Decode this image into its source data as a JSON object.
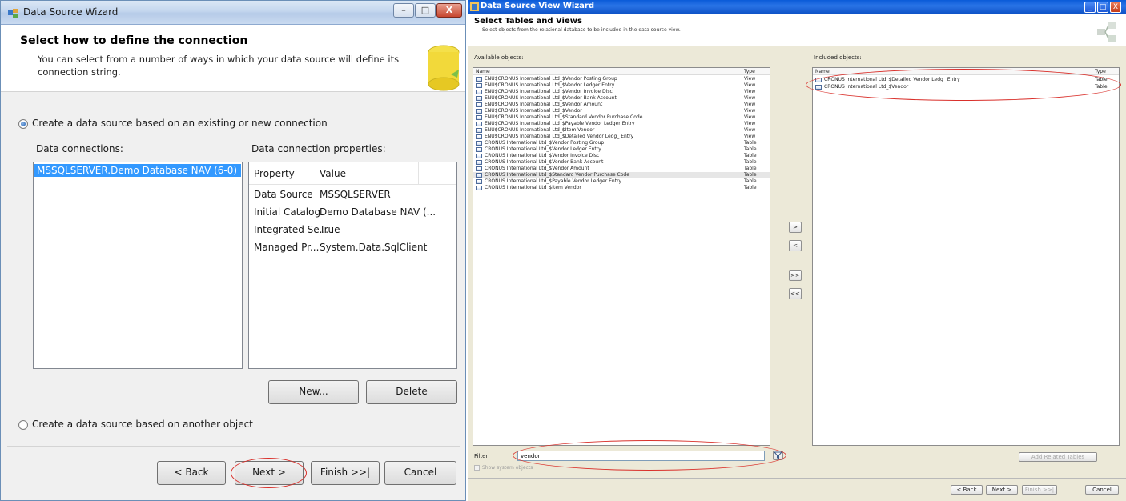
{
  "left": {
    "title": "Data Source Wizard",
    "header": {
      "title": "Select how to define the connection",
      "description": "You can select from a number of ways in which your data source will define its connection string."
    },
    "radio_existing": "Create a data source based on an existing or new connection",
    "data_connections_label": "Data connections:",
    "connection_item": "MSSQLSERVER.Demo Database NAV (6-0)",
    "properties_label": "Data connection properties:",
    "properties": {
      "col_property": "Property",
      "col_value": "Value",
      "rows": [
        {
          "property": "Data Source",
          "value": "MSSQLSERVER"
        },
        {
          "property": "Initial Catalog",
          "value": "Demo Database NAV (..."
        },
        {
          "property": "Integrated Se...",
          "value": "True"
        },
        {
          "property": "Managed Pr...",
          "value": "System.Data.SqlClient"
        }
      ]
    },
    "new_button": "New...",
    "delete_button": "Delete",
    "radio_other": "Create a data source based on another object",
    "back_button": "< Back",
    "next_button": "Next >",
    "finish_button": "Finish >>|",
    "cancel_button": "Cancel"
  },
  "right": {
    "title": "Data Source View Wizard",
    "header": {
      "title": "Select Tables and Views",
      "description": "Select objects from the relational database to be included in the data source view."
    },
    "available_label": "Available objects:",
    "col_name": "Name",
    "col_type": "Type",
    "available": [
      {
        "name": "ENU$CRONUS International Ltd_$Vendor Posting Group",
        "type": "View"
      },
      {
        "name": "ENU$CRONUS International Ltd_$Vendor Ledger Entry",
        "type": "View"
      },
      {
        "name": "ENU$CRONUS International Ltd_$Vendor Invoice Disc_",
        "type": "View"
      },
      {
        "name": "ENU$CRONUS International Ltd_$Vendor Bank Account",
        "type": "View"
      },
      {
        "name": "ENU$CRONUS International Ltd_$Vendor Amount",
        "type": "View"
      },
      {
        "name": "ENU$CRONUS International Ltd_$Vendor",
        "type": "View"
      },
      {
        "name": "ENU$CRONUS International Ltd_$Standard Vendor Purchase Code",
        "type": "View"
      },
      {
        "name": "ENU$CRONUS International Ltd_$Payable Vendor Ledger Entry",
        "type": "View"
      },
      {
        "name": "ENU$CRONUS International Ltd_$Item Vendor",
        "type": "View"
      },
      {
        "name": "ENU$CRONUS International Ltd_$Detailed Vendor Ledg_ Entry",
        "type": "View"
      },
      {
        "name": "CRONUS International Ltd_$Vendor Posting Group",
        "type": "Table"
      },
      {
        "name": "CRONUS International Ltd_$Vendor Ledger Entry",
        "type": "Table"
      },
      {
        "name": "CRONUS International Ltd_$Vendor Invoice Disc_",
        "type": "Table"
      },
      {
        "name": "CRONUS International Ltd_$Vendor Bank Account",
        "type": "Table"
      },
      {
        "name": "CRONUS International Ltd_$Vendor Amount",
        "type": "Table"
      },
      {
        "name": "CRONUS International Ltd_$Standard Vendor Purchase Code",
        "type": "Table"
      },
      {
        "name": "CRONUS International Ltd_$Payable Vendor Ledger Entry",
        "type": "Table"
      },
      {
        "name": "CRONUS International Ltd_$Item Vendor",
        "type": "Table"
      }
    ],
    "included_label": "Included objects:",
    "included": [
      {
        "name": "CRONUS International Ltd_$Detailed Vendor Ledg_ Entry",
        "type": "Table"
      },
      {
        "name": "CRONUS International Ltd_$Vendor",
        "type": "Table"
      }
    ],
    "move_right": ">",
    "move_left": "<",
    "move_all_right": ">>",
    "move_all_left": "<<",
    "filter_label": "Filter:",
    "filter_value": "vendor",
    "show_system": "Show system objects",
    "add_related": "Add Related Tables",
    "back_button": "< Back",
    "next_button": "Next >",
    "finish_button": "Finish >>|",
    "cancel_button": "Cancel"
  },
  "colors": {
    "selection": "#3399ff",
    "annotation": "#d9302b",
    "xp_title": "#0a5bd8"
  }
}
